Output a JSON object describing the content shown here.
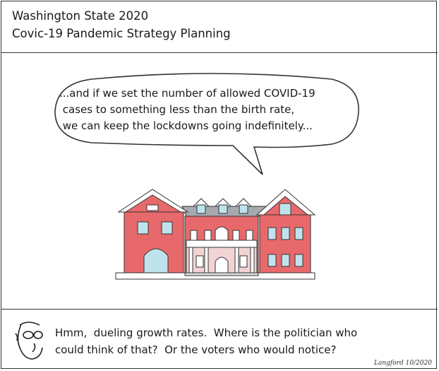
{
  "header": {
    "line1": "Washington State 2020",
    "line2": "Covic-19 Pandemic Strategy Planning"
  },
  "speech_bubble": {
    "text": "...and if we set the number of allowed COVID-19\n cases to something less than the birth rate,\n we can keep the lockdowns going indefinitely..."
  },
  "caption": {
    "text": "Hmm,  dueling growth rates.  Where is the politician who\ncould think of that?  Or the voters who would notice?"
  },
  "signature": "Langford  10/2020",
  "colors": {
    "building_brick": "#e8696b",
    "roof": "#a6a9ad",
    "trim": "#ffffff",
    "window": "#bfe3ec",
    "outline": "#333333"
  },
  "icons": {
    "mansion": "governor-mansion-illustration",
    "character": "cartoonist-face-icon"
  }
}
